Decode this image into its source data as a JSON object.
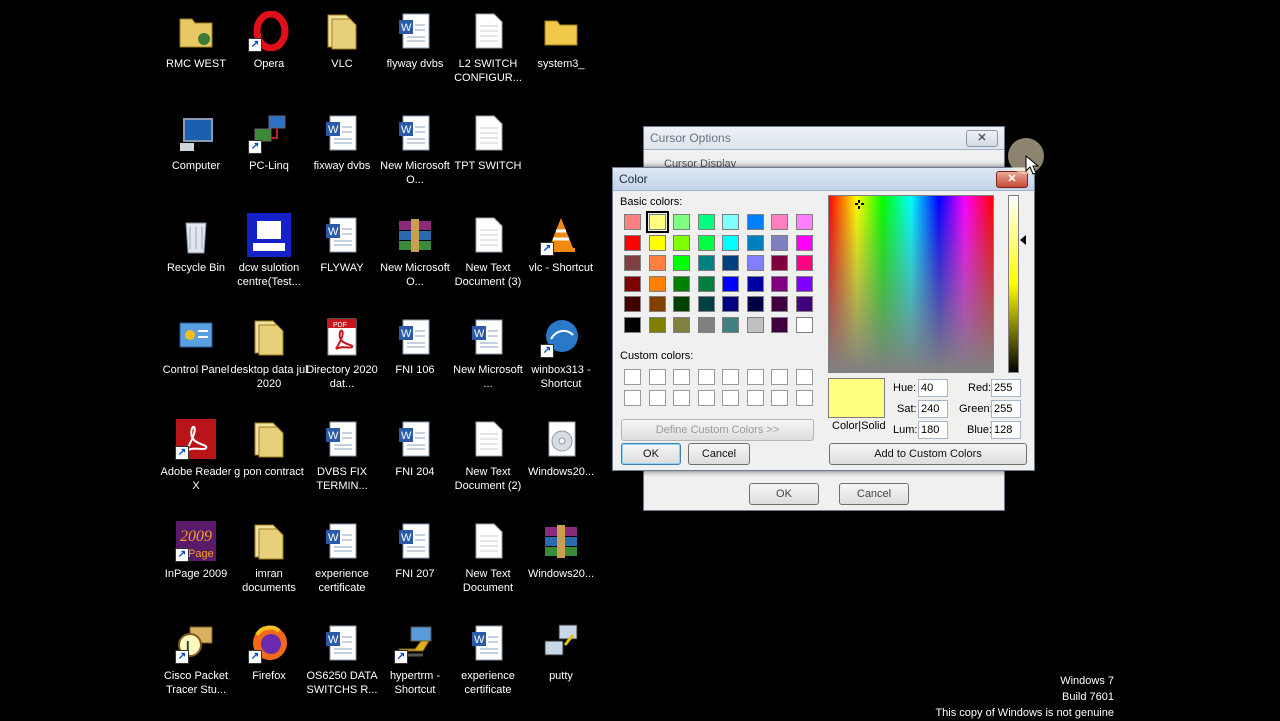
{
  "desktop": {
    "icons": [
      {
        "label": "RMC WEST"
      },
      {
        "label": "Opera"
      },
      {
        "label": "VLC"
      },
      {
        "label": "flyway dvbs"
      },
      {
        "label": "L2 SWITCH CONFIGUR..."
      },
      {
        "label": "system3_"
      },
      {
        "label": "Computer"
      },
      {
        "label": "PC-Linq"
      },
      {
        "label": "fixway dvbs"
      },
      {
        "label": "New Microsoft O..."
      },
      {
        "label": "TPT SWITCH"
      },
      {
        "label": "Recycle Bin"
      },
      {
        "label": "dcw sulotion centre(Test..."
      },
      {
        "label": "FLYWAY"
      },
      {
        "label": "New Microsoft O..."
      },
      {
        "label": "New Text Document (3)"
      },
      {
        "label": "vlc - Shortcut"
      },
      {
        "label": "Control Panel"
      },
      {
        "label": "desktop data jul 2020"
      },
      {
        "label": "Directory 2020 dat..."
      },
      {
        "label": "FNI 106"
      },
      {
        "label": "New Microsoft ..."
      },
      {
        "label": "winbox313 - Shortcut"
      },
      {
        "label": "Adobe Reader X"
      },
      {
        "label": "g pon contract"
      },
      {
        "label": "DVBS FIX TERMIN..."
      },
      {
        "label": "FNI 204"
      },
      {
        "label": "New Text Document (2)"
      },
      {
        "label": "Windows20..."
      },
      {
        "label": "InPage 2009"
      },
      {
        "label": "imran documents"
      },
      {
        "label": "experience certificate"
      },
      {
        "label": "FNI 207"
      },
      {
        "label": "New Text Document"
      },
      {
        "label": "Windows20..."
      },
      {
        "label": "Cisco Packet Tracer Stu..."
      },
      {
        "label": "Firefox"
      },
      {
        "label": "OS6250 DATA SWITCHS R..."
      },
      {
        "label": "hypertrm - Shortcut"
      },
      {
        "label": "experience certificate"
      },
      {
        "label": "putty"
      }
    ]
  },
  "cursor_options": {
    "title": "Cursor Options",
    "partial_label": "Cursor Display",
    "ok": "OK",
    "cancel": "Cancel"
  },
  "color_dialog": {
    "title": "Color",
    "basic_colors_label": "Basic colors:",
    "custom_colors_label": "Custom colors:",
    "define_custom": "Define Custom Colors >>",
    "ok": "OK",
    "cancel": "Cancel",
    "add_custom": "Add to Custom Colors",
    "color_solid": "Color|Solid",
    "selected_color": "#ffff80",
    "hue_label": "Hue:",
    "hue": "40",
    "sat_label": "Sat:",
    "sat": "240",
    "lum_label": "Lum:",
    "lum": "180",
    "red_label": "Red:",
    "red": "255",
    "green_label": "Green:",
    "green": "255",
    "blue_label": "Blue:",
    "blue": "128",
    "basic_colors": [
      "#ff8080",
      "#ffff80",
      "#80ff80",
      "#00ff80",
      "#80ffff",
      "#0080ff",
      "#ff80c0",
      "#ff80ff",
      "#ff0000",
      "#ffff00",
      "#80ff00",
      "#00ff40",
      "#00ffff",
      "#0080c0",
      "#8080c0",
      "#ff00ff",
      "#804040",
      "#ff8040",
      "#00ff00",
      "#008080",
      "#004080",
      "#8080ff",
      "#800040",
      "#ff0080",
      "#800000",
      "#ff8000",
      "#008000",
      "#008040",
      "#0000ff",
      "#0000a0",
      "#800080",
      "#8000ff",
      "#400000",
      "#804000",
      "#004000",
      "#004040",
      "#000080",
      "#000040",
      "#400040",
      "#400080",
      "#000000",
      "#808000",
      "#808040",
      "#808080",
      "#408080",
      "#c0c0c0",
      "#400040",
      "#ffffff"
    ]
  },
  "watermark": {
    "line1": "Windows 7",
    "line2": "Build 7601",
    "line3": "This copy of Windows is not genuine"
  }
}
